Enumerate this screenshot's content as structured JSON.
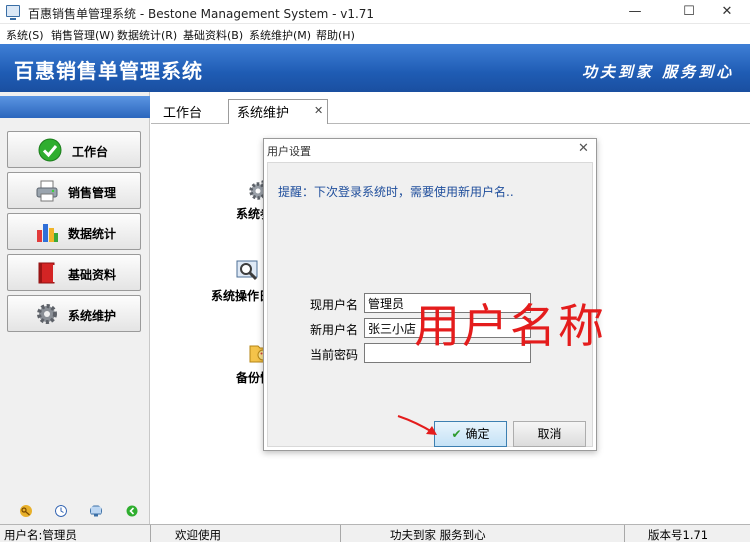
{
  "window": {
    "title": "百惠销售单管理系统 - Bestone Management System - v1.71",
    "min_glyph": "—",
    "max_glyph": "☐",
    "close_glyph": "✕"
  },
  "menu": [
    "系统(S)",
    "销售管理(W)",
    "数据统计(R)",
    "基础资料(B)",
    "系统维护(M)",
    "帮助(H)"
  ],
  "banner": {
    "app_name": "百惠销售单管理系统",
    "slogan": "功夫到家 服务到心"
  },
  "sidebar": {
    "items": [
      {
        "label": "工作台",
        "icon": "green-check-icon"
      },
      {
        "label": "销售管理",
        "icon": "printer-icon"
      },
      {
        "label": "数据统计",
        "icon": "bar-chart-icon"
      },
      {
        "label": "基础资料",
        "icon": "red-book-icon"
      },
      {
        "label": "系统维护",
        "icon": "gear-icon"
      }
    ],
    "bottom_icons": [
      "key-icon",
      "clock-icon",
      "monitor-icon",
      "green-arrow-icon"
    ]
  },
  "tabs": {
    "workbench": "工作台",
    "system_maintenance": "系统维护",
    "close_glyph": "✕"
  },
  "functions": [
    {
      "label": "系统参数",
      "icon": "gears-icon"
    },
    {
      "label": "系统操作日志",
      "icon": "search-log-icon"
    },
    {
      "label": "备份恢复",
      "icon": "folder-icon"
    }
  ],
  "dialog": {
    "title": "用户设置",
    "close_glyph": "✕",
    "hint": "提醒：下次登录系统时，需要使用新用户名..",
    "fields": {
      "current_username_label": "现用户名",
      "current_username_value": "管理员",
      "new_username_label": "新用户名",
      "new_username_value": "张三小店",
      "current_password_label": "当前密码",
      "current_password_value": ""
    },
    "ok_label": "确定",
    "cancel_label": "取消"
  },
  "annotation": {
    "text": "用户名称",
    "color": "#e41c1c"
  },
  "statusbar": {
    "user": "用户名:管理员",
    "welcome": "欢迎使用",
    "slogan": "功夫到家 服务到心",
    "version": "版本号1.71"
  },
  "colors": {
    "banner": "#1f5cb4",
    "hint": "#1f4e9c",
    "ok_border": "#3c7fb1"
  }
}
